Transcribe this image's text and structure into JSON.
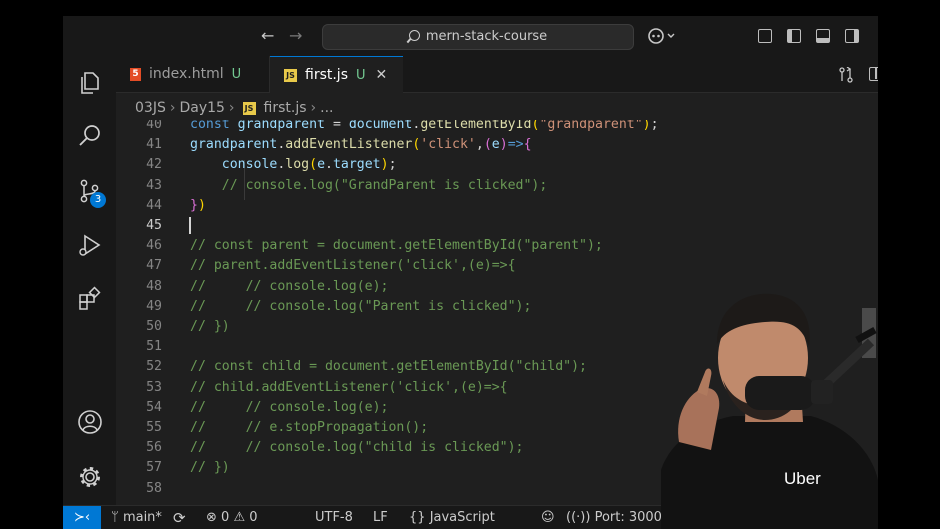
{
  "titlebar": {
    "search": "mern-stack-course",
    "back_icon": "arrow-left-icon",
    "forward_icon": "arrow-right-icon",
    "copilot_icon": "copilot-icon"
  },
  "activity": {
    "items": [
      "explorer-icon",
      "search-icon",
      "source-control-icon",
      "run-debug-icon",
      "extensions-icon"
    ],
    "scm_badge": "3",
    "bottom": [
      "account-icon",
      "settings-gear-icon"
    ]
  },
  "tabs": [
    {
      "name": "index.html",
      "status": "U",
      "icon": "html-file-icon",
      "icon_text": "5"
    },
    {
      "name": "first.js",
      "status": "U",
      "icon": "js-file-icon",
      "icon_text": "JS",
      "close": "✕"
    }
  ],
  "tab_actions": {
    "compare": "compare-changes-icon",
    "split": "split-editor-icon",
    "more": "⋯"
  },
  "breadcrumb": {
    "folder1": "03JS",
    "folder2": "Day15",
    "file": "first.js",
    "more": "...",
    "sep": "›",
    "file_icon_text": "JS"
  },
  "editor": {
    "active_line": 45,
    "lines": [
      {
        "n": "40",
        "html": "<span class='t-kw'>const</span> <span class='t-var'>grandparent</span> <span class='t-p'>=</span> <span class='t-var'>document</span><span class='t-p'>.</span><span class='t-fn'>getElementById</span><span class='t-br2'>(</span><span class='t-str'>\"grandparent\"</span><span class='t-br2'>)</span><span class='t-p'>;</span>"
      },
      {
        "n": "41",
        "html": "<span class='t-var'>grandparent</span><span class='t-p'>.</span><span class='t-fn'>addEventListener</span><span class='t-br2'>(</span><span class='t-str'>'click'</span><span class='t-p'>,</span><span class='t-br'>(</span><span class='t-var'>e</span><span class='t-br'>)</span><span class='t-kw'>=></span><span class='t-br'>{</span>"
      },
      {
        "n": "42",
        "html": "    <span class='t-var'>console</span><span class='t-p'>.</span><span class='t-fn'>log</span><span class='t-br2'>(</span><span class='t-var'>e</span><span class='t-p'>.</span><span class='t-var'>target</span><span class='t-br2'>)</span><span class='t-p'>;</span>"
      },
      {
        "n": "43",
        "html": "    <span class='t-cm'>// console.log(\"GrandParent is clicked\");</span>"
      },
      {
        "n": "44",
        "html": "<span class='t-br'>}</span><span class='t-br2'>)</span>"
      },
      {
        "n": "45",
        "html": ""
      },
      {
        "n": "46",
        "html": "<span class='t-cm'>// const parent = document.getElementById(\"parent\");</span>"
      },
      {
        "n": "47",
        "html": "<span class='t-cm'>// parent.addEventListener('click',(e)=>{</span>"
      },
      {
        "n": "48",
        "html": "<span class='t-cm'>//     // console.log(e);</span>"
      },
      {
        "n": "49",
        "html": "<span class='t-cm'>//     // console.log(\"Parent is clicked\");</span>"
      },
      {
        "n": "50",
        "html": "<span class='t-cm'>// })</span>"
      },
      {
        "n": "51",
        "html": ""
      },
      {
        "n": "52",
        "html": "<span class='t-cm'>// const child = document.getElementById(\"child\");</span>"
      },
      {
        "n": "53",
        "html": "<span class='t-cm'>// child.addEventListener('click',(e)=>{</span>"
      },
      {
        "n": "54",
        "html": "<span class='t-cm'>//     // console.log(e);</span>"
      },
      {
        "n": "55",
        "html": "<span class='t-cm'>//     // e.stopPropagation();</span>"
      },
      {
        "n": "56",
        "html": "<span class='t-cm'>//     // console.log(\"child is clicked\");</span>"
      },
      {
        "n": "57",
        "html": "<span class='t-cm'>// })</span>"
      },
      {
        "n": "58",
        "html": ""
      }
    ]
  },
  "status": {
    "remote_icon": "remote-icon",
    "branch": "main*",
    "errors": "0",
    "warnings": "0",
    "encoding": "UTF-8",
    "eol": "LF",
    "language": "JavaScript",
    "port": "Port: 3000"
  },
  "webcam": {
    "shirt_logo": "Uber"
  },
  "colors": {
    "accent": "#0078d4",
    "editor_bg": "#1f1f1f",
    "chrome_bg": "#181818",
    "comment": "#6a9955"
  }
}
